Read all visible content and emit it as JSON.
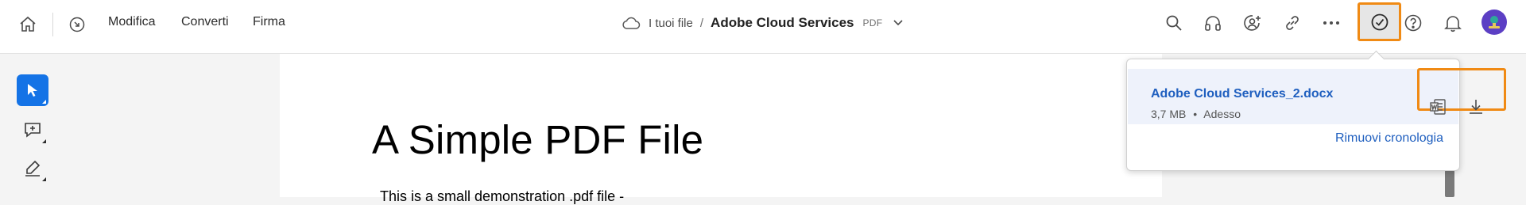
{
  "header": {
    "home_icon": "home-icon",
    "history_icon": "recent-icon",
    "menu": [
      "Modifica",
      "Converti",
      "Firma"
    ],
    "breadcrumb": {
      "cloud_icon": "cloud-icon",
      "root": "I tuoi file",
      "separator": "/",
      "document": "Adobe Cloud Services",
      "doc_type": "PDF"
    },
    "actions": [
      "search-icon",
      "headset-icon",
      "add-user-icon",
      "link-icon",
      "more-icon",
      "check-circle-icon",
      "help-icon",
      "bell-icon",
      "avatar"
    ]
  },
  "left_toolbar": {
    "tools": [
      "select-icon",
      "add-comment-icon",
      "draw-icon"
    ],
    "active_tool": "select-icon",
    "accent": "#1473e6"
  },
  "document": {
    "title": "A Simple PDF File",
    "body_first_line": "This is a small demonstration .pdf file -"
  },
  "downloads_popover": {
    "file_name": "Adobe Cloud Services_2.docx",
    "file_size": "3,7 MB",
    "bullet": "•",
    "time": "Adesso",
    "actions": [
      "word-file-icon",
      "download-icon"
    ],
    "clear_label": "Rimuovi cronologia"
  },
  "colors": {
    "highlight": "#f08a14",
    "link": "#1f5fbf",
    "row_bg": "#eef2fb"
  }
}
